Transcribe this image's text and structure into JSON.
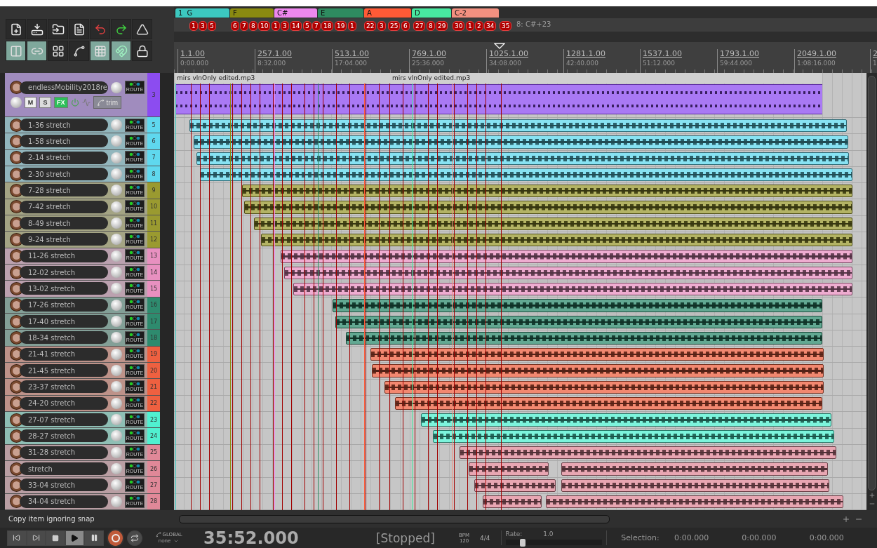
{
  "toolbar": {
    "rows": [
      [
        {
          "on": false
        },
        {
          "on": false
        },
        {
          "on": false
        },
        {
          "on": false
        },
        {
          "on": false
        },
        {
          "on": false
        },
        {
          "on": false
        }
      ],
      [
        {
          "on": true
        },
        {
          "on": true
        },
        {
          "on": false
        },
        {
          "on": false
        },
        {
          "on": true
        },
        {
          "on": true
        },
        {
          "on": false
        }
      ]
    ]
  },
  "regions": [
    {
      "number": "1",
      "name": "G",
      "color": "#3cc8c0"
    },
    {
      "name": "F",
      "color": "#8a8a10"
    },
    {
      "name": "C#",
      "color": "#ee88ee"
    },
    {
      "name": "E",
      "color": "#2e8b60"
    },
    {
      "name": "A",
      "color": "#ff5a36"
    },
    {
      "name": "D",
      "color": "#48e8a0"
    },
    {
      "name": "C-2",
      "color": "#f29080"
    }
  ],
  "markers": [
    {
      "label": "1"
    },
    {
      "label": "3"
    },
    {
      "label": "5"
    },
    {
      "label": "6"
    },
    {
      "label": "7"
    },
    {
      "label": "8"
    },
    {
      "label": "10"
    },
    {
      "label": "1"
    },
    {
      "label": "3"
    },
    {
      "label": "14"
    },
    {
      "label": "5"
    },
    {
      "label": "7"
    },
    {
      "label": "18"
    },
    {
      "label": "19"
    },
    {
      "label": "1"
    },
    {
      "label": "22"
    },
    {
      "label": "3"
    },
    {
      "label": "25"
    },
    {
      "label": "6"
    },
    {
      "label": "27"
    },
    {
      "label": "8"
    },
    {
      "label": "29"
    },
    {
      "label": "30"
    },
    {
      "label": "1"
    },
    {
      "label": "2"
    },
    {
      "label": "34"
    },
    {
      "label": "35"
    }
  ],
  "marker_note": "8: C#+23",
  "ruler": [
    {
      "bar": "1.1.00",
      "time": "0:00.000"
    },
    {
      "bar": "257.1.00",
      "time": "8:32.000"
    },
    {
      "bar": "513.1.00",
      "time": "17:04.000"
    },
    {
      "bar": "769.1.00",
      "time": "25:36.000"
    },
    {
      "bar": "1025.1.00",
      "time": "34:08.000"
    },
    {
      "bar": "1281.1.00",
      "time": "42:40.000"
    },
    {
      "bar": "1537.1.00",
      "time": "51:12.000"
    },
    {
      "bar": "1793.1.00",
      "time": "59:44.000"
    },
    {
      "bar": "2049.1.00",
      "time": "1:08:16.000"
    },
    {
      "bar": "2",
      "time": "1"
    }
  ],
  "tracks": [
    {
      "kind": "folder",
      "name": "endlessMobility2018re",
      "number": "3",
      "color": "#8c4cf0",
      "route": "ROUTE",
      "mute": "M",
      "solo": "S",
      "fx": "FX",
      "fx_on": true,
      "trim": "trim",
      "items": [
        {
          "label": "mirs vlnOnly edited.mp3"
        },
        {
          "label": "mirs vlnOnly edited.mp3"
        }
      ]
    },
    {
      "kind": "track",
      "name": "1-36 stretch",
      "number": "5",
      "color": "#5fd8ee",
      "route": "ROUTE"
    },
    {
      "kind": "track",
      "name": "1-58 stretch",
      "number": "6",
      "color": "#5fd8ee",
      "route": "ROUTE"
    },
    {
      "kind": "track",
      "name": "2-14 stretch",
      "number": "7",
      "color": "#5fd8ee",
      "route": "ROUTE"
    },
    {
      "kind": "track",
      "name": "2-30 stretch",
      "number": "8",
      "color": "#5fd8ee",
      "route": "ROUTE"
    },
    {
      "kind": "track",
      "name": "7-28 stretch",
      "number": "9",
      "color": "#9a9a30",
      "route": "ROUTE"
    },
    {
      "kind": "track",
      "name": "7-42 stretch",
      "number": "10",
      "color": "#9a9a30",
      "route": "ROUTE"
    },
    {
      "kind": "track",
      "name": "8-49 stretch",
      "number": "11",
      "color": "#9a9a30",
      "route": "ROUTE"
    },
    {
      "kind": "track",
      "name": "9-24 stretch",
      "number": "12",
      "color": "#9a9a30",
      "route": "ROUTE"
    },
    {
      "kind": "track",
      "name": "11-26 stretch",
      "number": "13",
      "color": "#e890c0",
      "route": "ROUTE"
    },
    {
      "kind": "track",
      "name": "12-02 stretch",
      "number": "14",
      "color": "#e890c0",
      "route": "ROUTE"
    },
    {
      "kind": "track",
      "name": "13-02 stretch",
      "number": "15",
      "color": "#e890c0",
      "route": "ROUTE"
    },
    {
      "kind": "track",
      "name": "17-26 stretch",
      "number": "16",
      "color": "#2e8b6e",
      "route": "ROUTE"
    },
    {
      "kind": "track",
      "name": "17-40 stretch",
      "number": "17",
      "color": "#2e8b6e",
      "route": "ROUTE"
    },
    {
      "kind": "track",
      "name": "18-34 stretch",
      "number": "18",
      "color": "#2e8b6e",
      "route": "ROUTE"
    },
    {
      "kind": "track",
      "name": "21-41 stretch",
      "number": "19",
      "color": "#ee6040",
      "route": "ROUTE"
    },
    {
      "kind": "track",
      "name": "21-45 stretch",
      "number": "20",
      "color": "#ee6040",
      "route": "ROUTE"
    },
    {
      "kind": "track",
      "name": "23-37 stretch",
      "number": "21",
      "color": "#ee6040",
      "route": "ROUTE"
    },
    {
      "kind": "track",
      "name": "24-20 stretch",
      "number": "22",
      "color": "#ee6040",
      "route": "ROUTE"
    },
    {
      "kind": "track",
      "name": "27-07 stretch",
      "number": "23",
      "color": "#50f0d0",
      "route": "ROUTE"
    },
    {
      "kind": "track",
      "name": "28-27 stretch",
      "number": "24",
      "color": "#50f0d0",
      "route": "ROUTE"
    },
    {
      "kind": "track",
      "name": "31-28 stretch",
      "number": "25",
      "color": "#e08898",
      "route": "ROUTE"
    },
    {
      "kind": "track",
      "name": "stretch",
      "number": "26",
      "color": "#e08898",
      "route": "ROUTE"
    },
    {
      "kind": "track",
      "name": "33-04 stretch",
      "number": "27",
      "color": "#e08898",
      "route": "ROUTE"
    },
    {
      "kind": "track",
      "name": "34-04 stretch",
      "number": "28",
      "color": "#e08898",
      "route": "ROUTE"
    }
  ],
  "status_text": "Copy item ignoring snap",
  "transport": {
    "buttons": [
      {
        "kind": "start",
        "selected": false
      },
      {
        "kind": "end",
        "selected": false
      },
      {
        "kind": "stop",
        "selected": false
      },
      {
        "kind": "play",
        "selected": true
      },
      {
        "kind": "pause",
        "selected": false
      },
      {
        "kind": "record",
        "selected": false
      },
      {
        "kind": "repeat",
        "selected": false
      }
    ],
    "global_label": "GLOBAL",
    "automation_mode": "none",
    "time": "35:52.000",
    "state": "[Stopped]",
    "bpm_label": "BPM",
    "bpm": "120",
    "signature": "4/4",
    "rate_label": "Rate:",
    "rate": "1.0",
    "rate_slider": {
      "level": 0.15
    },
    "selection_label": "Selection:",
    "selection": [
      "0:00.000",
      "0:00.000",
      "0:00.000"
    ]
  }
}
